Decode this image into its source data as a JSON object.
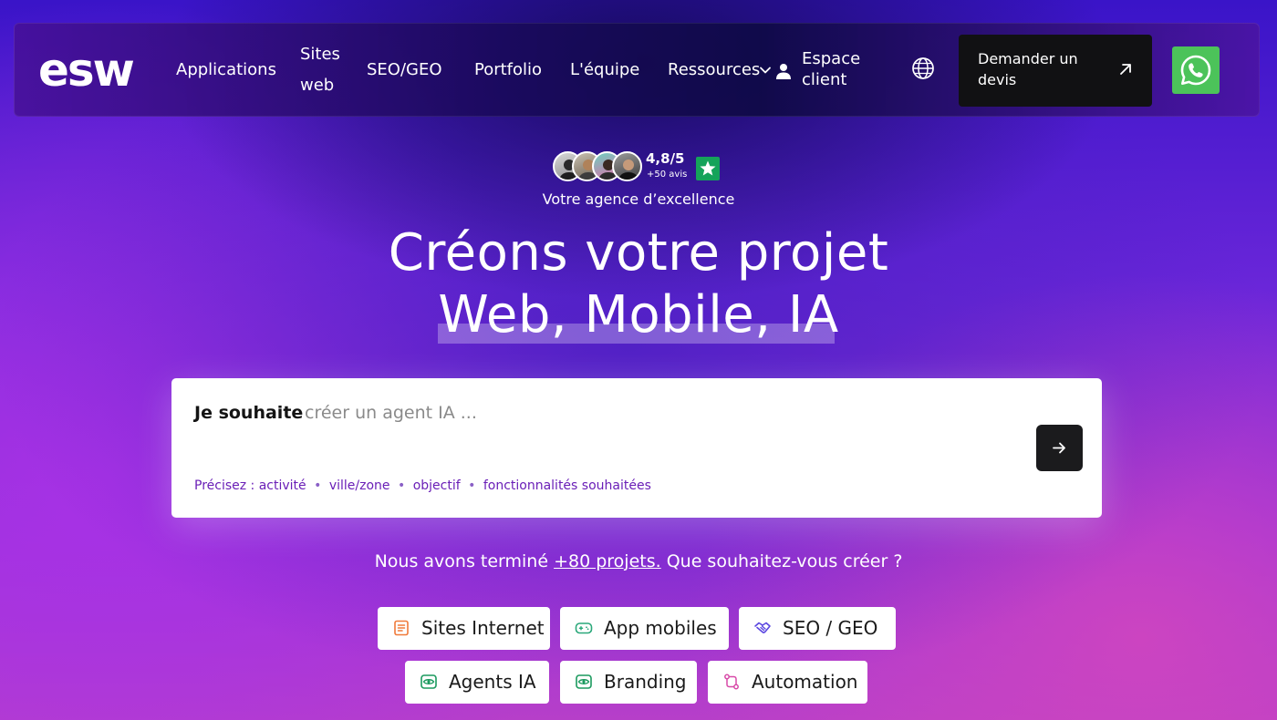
{
  "nav": {
    "logo": "esw",
    "items": [
      "Applications",
      "Sites web",
      "SEO/GEO",
      "Portfolio",
      "L'équipe",
      "Ressources"
    ],
    "client_label": "Espace client",
    "cta_label": "Demander un devis",
    "icons": [
      "chevron-down-icon",
      "user-icon",
      "globe-icon",
      "arrow-up-right-icon",
      "whatsapp-icon"
    ]
  },
  "hero": {
    "rating": "4,8/5",
    "reviews": "+50 avis",
    "tagline": "Votre agence d’excellence",
    "title_line1": "Créons votre projet",
    "title_line2": "Web, Mobile, IA"
  },
  "search": {
    "label": "Je souhaite",
    "placeholder": "créer un agent IA ...",
    "hints": [
      "Précisez : activité",
      "ville/zone",
      "objectif",
      "fonctionnalités souhaitées"
    ],
    "hint_separator": "•"
  },
  "projects": {
    "prefix": "Nous avons terminé",
    "link": "+80 projets.",
    "suffix": "Que souhaitez-vous créer ?"
  },
  "categories": [
    {
      "label": "Sites Internet",
      "icon": "document-icon",
      "color": "#f07a3a"
    },
    {
      "label": "App mobiles",
      "icon": "gamepad-icon",
      "color": "#2aa87a"
    },
    {
      "label": "SEO / GEO",
      "icon": "handshake-icon",
      "color": "#5a46e0"
    },
    {
      "label": "Agents IA",
      "icon": "eye-icon",
      "color": "#1b9a5e"
    },
    {
      "label": "Branding",
      "icon": "eye-icon",
      "color": "#1b9a5e"
    },
    {
      "label": "Automation",
      "icon": "workflow-icon",
      "color": "#d84aa8"
    }
  ],
  "colors": {
    "accent": "#6a1fb7",
    "cta_bg": "#111113",
    "whatsapp": "#4cc35a",
    "trust_green": "#15a35a"
  }
}
